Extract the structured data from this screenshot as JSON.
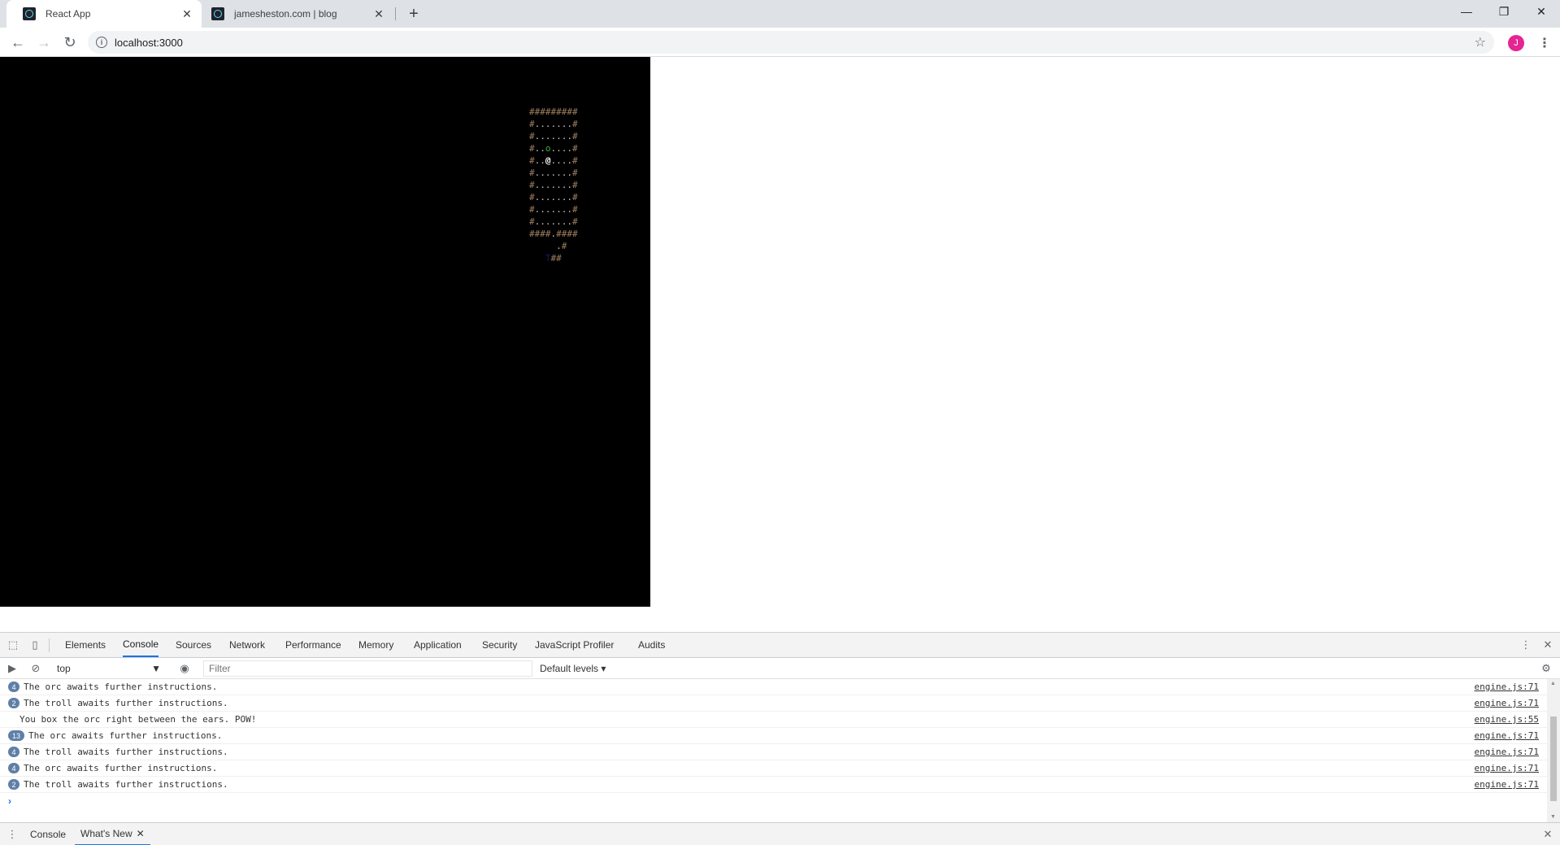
{
  "tabs": [
    {
      "title": "React App",
      "active": true
    },
    {
      "title": "jamesheston.com | blog",
      "active": false
    }
  ],
  "address": {
    "url": "localhost:3000"
  },
  "profile": {
    "initial": "J"
  },
  "game": {
    "map_rows": [
      [
        "#########",
        "wall"
      ],
      [
        [
          "#",
          "wall"
        ],
        [
          ".......",
          "floor"
        ],
        [
          "#",
          "wall"
        ]
      ],
      [
        [
          "#",
          "wall"
        ],
        [
          ".......",
          "floor"
        ],
        [
          "#",
          "wall"
        ]
      ],
      [
        [
          "#",
          "wall"
        ],
        [
          "..",
          "floor"
        ],
        [
          "o",
          "orc"
        ],
        [
          "....",
          "floor"
        ],
        [
          "#",
          "wall"
        ]
      ],
      [
        [
          "#",
          "wall"
        ],
        [
          "..",
          "floor"
        ],
        [
          "@",
          "player"
        ],
        [
          "....",
          "floor"
        ],
        [
          "#",
          "wall"
        ]
      ],
      [
        [
          "#",
          "wall"
        ],
        [
          ".......",
          "floor"
        ],
        [
          "#",
          "wall"
        ]
      ],
      [
        [
          "#",
          "wall"
        ],
        [
          ".......",
          "floor"
        ],
        [
          "#",
          "wall"
        ]
      ],
      [
        [
          "#",
          "wall"
        ],
        [
          ".......",
          "floor"
        ],
        [
          "#",
          "wall"
        ]
      ],
      [
        [
          "#",
          "wall"
        ],
        [
          ".......",
          "floor"
        ],
        [
          "#",
          "wall"
        ]
      ],
      [
        [
          "#",
          "wall"
        ],
        [
          ".......",
          "floor"
        ],
        [
          "#",
          "wall"
        ]
      ],
      [
        [
          "####",
          "wall"
        ],
        [
          ".",
          "floor"
        ],
        [
          "####",
          "wall"
        ]
      ],
      [
        [
          "     ",
          "wall"
        ],
        [
          ".",
          "floor"
        ],
        [
          "#",
          "wall"
        ]
      ],
      [
        [
          "   ",
          "wall"
        ],
        [
          "T",
          "dark"
        ],
        [
          "##",
          "wall"
        ]
      ]
    ]
  },
  "devtools": {
    "tabs": [
      "Elements",
      "Console",
      "Sources",
      "Network",
      "Performance",
      "Memory",
      "Application",
      "Security",
      "JavaScript Profiler",
      "Audits"
    ],
    "active_tab": "Console",
    "context": "top",
    "filter_placeholder": "Filter",
    "levels": "Default levels ▾",
    "logs": [
      {
        "count": "4",
        "msg": "The orc awaits further instructions.",
        "src": "engine.js:71"
      },
      {
        "count": "2",
        "msg": "The troll awaits further instructions.",
        "src": "engine.js:71"
      },
      {
        "count": "",
        "msg": "You box the orc right between the ears. POW!",
        "src": "engine.js:55"
      },
      {
        "count": "13",
        "msg": "The orc awaits further instructions.",
        "src": "engine.js:71"
      },
      {
        "count": "4",
        "msg": "The troll awaits further instructions.",
        "src": "engine.js:71"
      },
      {
        "count": "4",
        "msg": "The orc awaits further instructions.",
        "src": "engine.js:71"
      },
      {
        "count": "2",
        "msg": "The troll awaits further instructions.",
        "src": "engine.js:71"
      }
    ],
    "drawer_tabs": [
      "Console",
      "What's New"
    ]
  },
  "icons": {
    "back": "arrow-left-icon",
    "forward": "arrow-right-icon",
    "reload": "reload-icon",
    "info": "info-icon",
    "star": "star-icon",
    "inspect": "inspect-icon",
    "device": "device-toggle-icon",
    "clear": "clear-console-icon",
    "eye": "eye-icon",
    "gear": "gear-icon"
  },
  "colors": {
    "accent": "#1a73e8",
    "badge": "#5e7fa8",
    "wall": "#a08060",
    "orc": "#3fae3f"
  }
}
